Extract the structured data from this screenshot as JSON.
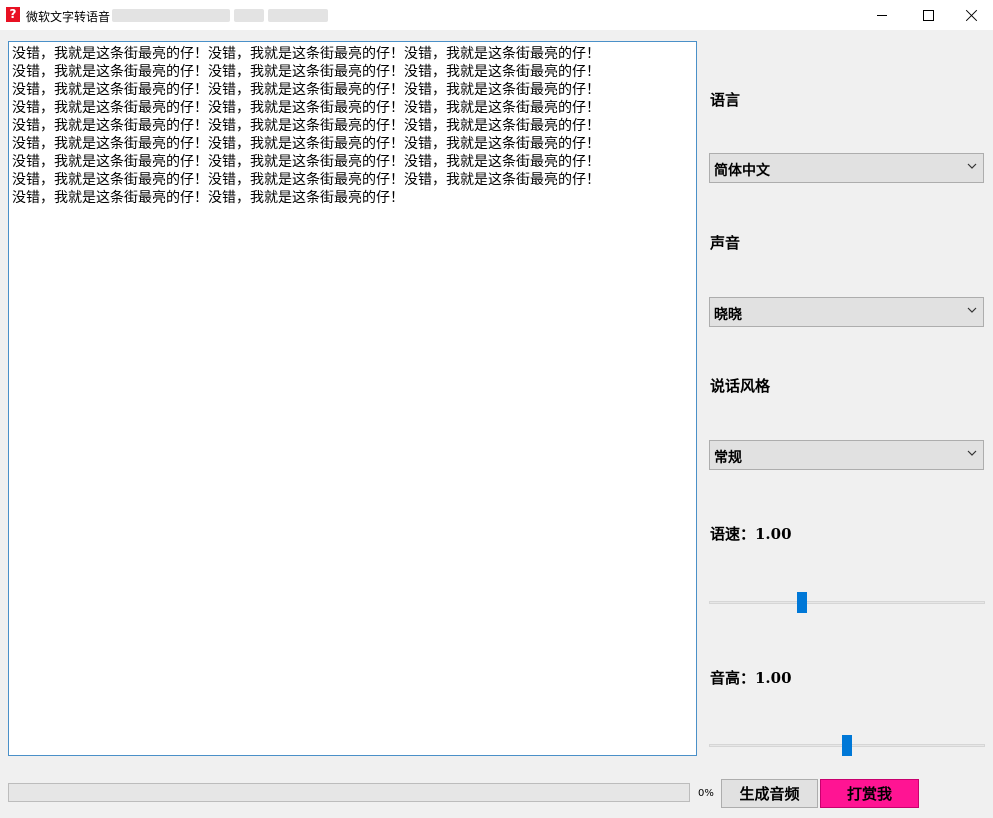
{
  "window": {
    "title": "微软文字转语音",
    "app_icon": "question-mark-icon",
    "controls": [
      "minimize-icon",
      "maximize-icon",
      "close-icon"
    ]
  },
  "editor": {
    "text": "没错，我就是这条街最亮的仔！没错，我就是这条街最亮的仔！没错，我就是这条街最亮的仔！\n没错，我就是这条街最亮的仔！没错，我就是这条街最亮的仔！没错，我就是这条街最亮的仔！\n没错，我就是这条街最亮的仔！没错，我就是这条街最亮的仔！没错，我就是这条街最亮的仔！\n没错，我就是这条街最亮的仔！没错，我就是这条街最亮的仔！没错，我就是这条街最亮的仔！\n没错，我就是这条街最亮的仔！没错，我就是这条街最亮的仔！没错，我就是这条街最亮的仔！\n没错，我就是这条街最亮的仔！没错，我就是这条街最亮的仔！没错，我就是这条街最亮的仔！\n没错，我就是这条街最亮的仔！没错，我就是这条街最亮的仔！没错，我就是这条街最亮的仔！\n没错，我就是这条街最亮的仔！没错，我就是这条街最亮的仔！没错，我就是这条街最亮的仔！\n没错，我就是这条街最亮的仔！没错，我就是这条街最亮的仔！"
  },
  "settings": {
    "language_label": "语言",
    "language_value": "简体中文",
    "voice_label": "声音",
    "voice_value": "晓晓",
    "style_label": "说话风格",
    "style_value": "常规",
    "rate_label": "语速：1.00",
    "rate_position": 0.33,
    "pitch_label": "音高：1.00",
    "pitch_position": 0.5
  },
  "footer": {
    "progress_value": 0,
    "progress_text": "0%",
    "generate_label": "生成音频",
    "tip_label": "打赏我",
    "tip_color": "#ff1493",
    "accent_color": "#0078d7"
  }
}
